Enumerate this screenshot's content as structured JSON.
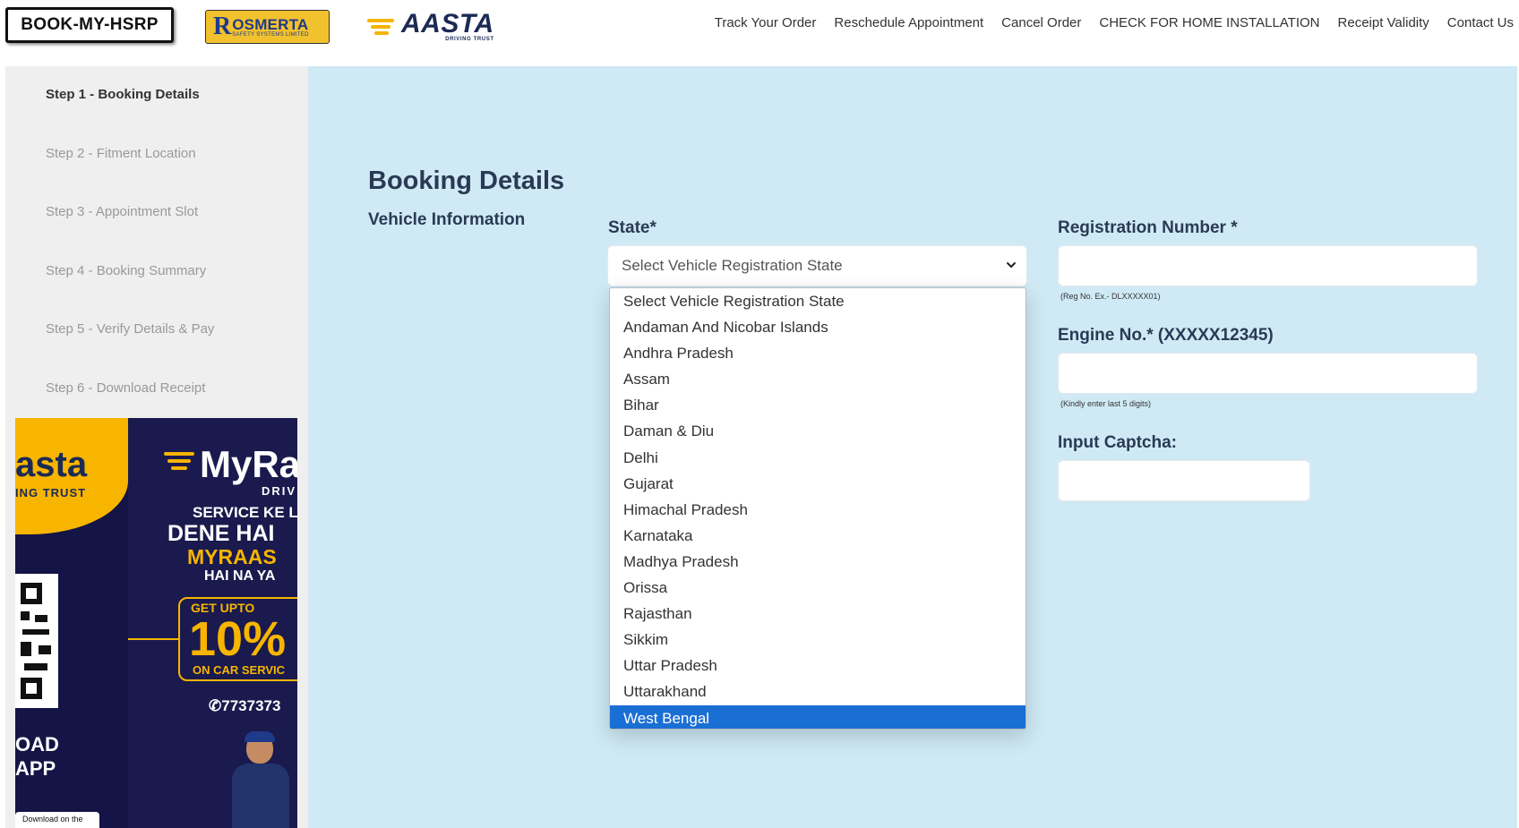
{
  "header": {
    "logo_hsrp": "BOOK-MY-HSRP",
    "logo_rosmerta_name": "OSMERTA",
    "logo_rosmerta_initial": "R",
    "logo_rosmerta_sub": "SAFETY SYSTEMS LIMITED",
    "logo_raasta_name": "AASTA",
    "logo_raasta_sub": "DRIVING TRUST",
    "nav": [
      "Track Your Order",
      "Reschedule Appointment",
      "Cancel Order",
      "CHECK FOR HOME INSTALLATION",
      "Receipt Validity",
      "Contact Us"
    ]
  },
  "sidebar": {
    "steps": [
      {
        "label": "Step 1 - Booking Details",
        "active": true
      },
      {
        "label": "Step 2 - Fitment Location",
        "active": false
      },
      {
        "label": "Step 3 - Appointment Slot",
        "active": false
      },
      {
        "label": "Step 4 - Booking Summary",
        "active": false
      },
      {
        "label": "Step 5 - Verify Details & Pay",
        "active": false
      },
      {
        "label": "Step 6 - Download Receipt",
        "active": false
      }
    ],
    "banner": {
      "asta": "asta",
      "trust": "ING TRUST",
      "brand": "MyRa",
      "driv": "DRIV",
      "line1": "SERVICE KE L",
      "line2": "DENE HAI",
      "line3": "MYRAAS",
      "line4": "HAI NA YA",
      "upto": "GET UPTO",
      "pct": "10%",
      "oncar": "ON CAR SERVIC",
      "phone": "7737373",
      "oad": "OAD",
      "app": "APP",
      "store": "Download on the"
    }
  },
  "main": {
    "page_title": "Booking Details",
    "section_title": "Vehicle Information",
    "state_label": "State*",
    "state_select_value": "Select Vehicle Registration State",
    "state_options": [
      "Select Vehicle Registration State",
      "Andaman And Nicobar Islands",
      "Andhra Pradesh",
      "Assam",
      "Bihar",
      "Daman & Diu",
      "Delhi",
      "Gujarat",
      "Himachal Pradesh",
      "Karnataka",
      "Madhya Pradesh",
      "Orissa",
      "Rajasthan",
      "Sikkim",
      "Uttar Pradesh",
      "Uttarakhand",
      "West Bengal"
    ],
    "highlighted_option": "West Bengal",
    "reg_label": "Registration Number *",
    "reg_hint": "(Reg No. Ex.- DLXXXXX01)",
    "reg_value": "",
    "engine_label": "Engine No.* (XXXXX12345)",
    "engine_hint": "(Kindly enter last 5 digits)",
    "engine_value": "",
    "captcha_label": "Input Captcha:",
    "captcha_value": ""
  },
  "colors": {
    "main_bg": "#cfeaf5",
    "sidebar_bg": "#efefef",
    "selected_option": "#1a6fd4",
    "brand_yellow": "#f7b500",
    "heading": "#2a3a55"
  }
}
